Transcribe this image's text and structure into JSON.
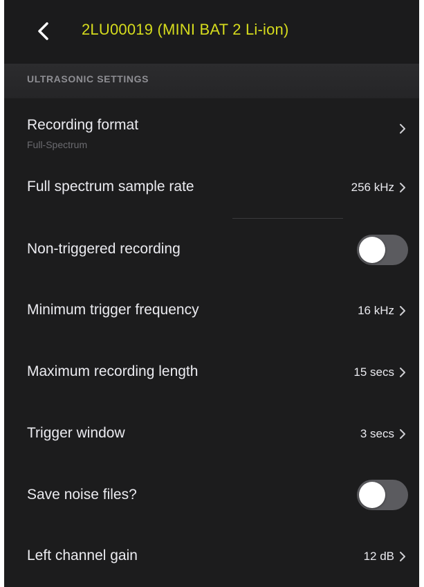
{
  "nav": {
    "title": "2LU00019 (MINI BAT 2 Li-ion)",
    "back_icon": "chevron-left-icon",
    "title_color": "#d6dc1d"
  },
  "section": {
    "title": "ULTRASONIC SETTINGS"
  },
  "rows": [
    {
      "label": "Recording format",
      "subtitle": "Full-Spectrum",
      "value": "",
      "control": "chevron"
    },
    {
      "label": "Full spectrum sample rate",
      "value": "256 kHz",
      "control": "chevron"
    },
    {
      "label": "Non-triggered recording",
      "control": "toggle",
      "on": false
    },
    {
      "label": "Minimum trigger frequency",
      "value": "16 kHz",
      "control": "chevron"
    },
    {
      "label": "Maximum recording length",
      "value": "15 secs",
      "control": "chevron"
    },
    {
      "label": "Trigger window",
      "value": "3 secs",
      "control": "chevron"
    },
    {
      "label": "Save noise files?",
      "control": "toggle",
      "on": false
    },
    {
      "label": "Left channel gain",
      "value": "12 dB",
      "control": "chevron"
    }
  ]
}
